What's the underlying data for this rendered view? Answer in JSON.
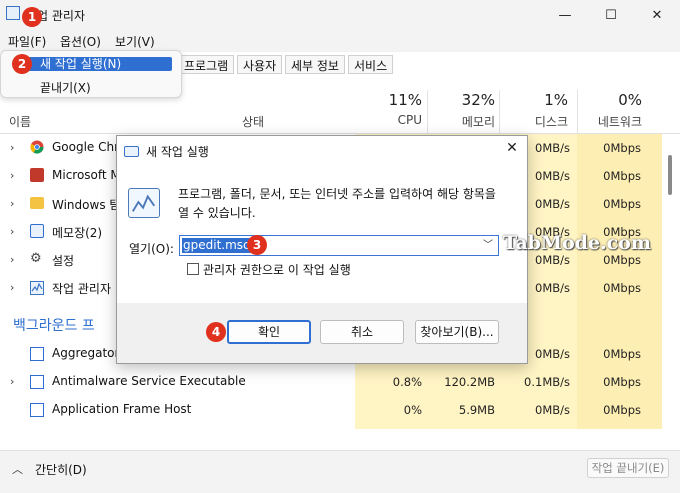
{
  "window": {
    "title": "작업 관리자",
    "controls": {
      "minimize": "—",
      "maximize": "☐",
      "close": "✕"
    }
  },
  "menubar": {
    "file": "파일(F)",
    "options": "옵션(O)",
    "view": "보기(V)"
  },
  "file_menu": {
    "items": [
      "새 작업 실행(N)",
      "끝내기(X)"
    ]
  },
  "tabs": [
    "프로그램",
    "사용자",
    "세부 정보",
    "서비스"
  ],
  "columns": {
    "name": "이름",
    "status": "상태",
    "cpu": {
      "pct": "11%",
      "label": "CPU"
    },
    "memory": {
      "pct": "32%",
      "label": "메모리"
    },
    "disk": {
      "pct": "1%",
      "label": "디스크"
    },
    "network": {
      "pct": "0%",
      "label": "네트워크"
    }
  },
  "apps": [
    {
      "name": "Google Chro",
      "icon": "chrome-icon",
      "disk": "0MB/s",
      "network": "0Mbps"
    },
    {
      "name": "Microsoft M",
      "icon": "app-icon",
      "disk": "0MB/s",
      "network": "0Mbps"
    },
    {
      "name": "Windows 탐",
      "icon": "folder-icon",
      "disk": "0MB/s",
      "network": "0Mbps"
    },
    {
      "name": "메모장(2)",
      "icon": "notepad-icon",
      "disk": "0MB/s",
      "network": "0Mbps"
    },
    {
      "name": "설정",
      "icon": "gear-icon",
      "disk": "0MB/s",
      "network": "0Mbps"
    },
    {
      "name": "작업 관리자",
      "icon": "task-manager-icon",
      "disk": "0MB/s",
      "network": "0Mbps"
    }
  ],
  "background_section": {
    "title": "백그라운드 프",
    "rows": [
      {
        "name": "Aggregator",
        "cpu": "",
        "memory": "",
        "disk": "0MB/s",
        "network": "0Mbps"
      },
      {
        "name": "Antimalware Service Executable",
        "cpu": "0.8%",
        "memory": "120.2MB",
        "disk": "0.1MB/s",
        "network": "0Mbps"
      },
      {
        "name": "Application Frame Host",
        "cpu": "0%",
        "memory": "5.9MB",
        "disk": "0MB/s",
        "network": "0Mbps"
      }
    ]
  },
  "footer": {
    "collapse": "간단히(D)",
    "end_task": "작업 끝내기(E)"
  },
  "dialog": {
    "title": "새 작업 실행",
    "close": "✕",
    "description": "프로그램, 폴더, 문서, 또는 인터넷 주소를 입력하여 해당 항목을 열 수 있습니다.",
    "open_label": "열기(O):",
    "input_value": "gpedit.msc",
    "admin_checkbox": "관리자 권한으로 이 작업 실행",
    "ok": "확인",
    "cancel": "취소",
    "browse": "찾아보기(B)..."
  },
  "markers": [
    "1",
    "2",
    "3",
    "4"
  ],
  "watermark": "TabMode.com",
  "colors": {
    "accent": "#2f6fd1",
    "marker": "#e0301e",
    "highlight_col": "#fff4c4"
  }
}
